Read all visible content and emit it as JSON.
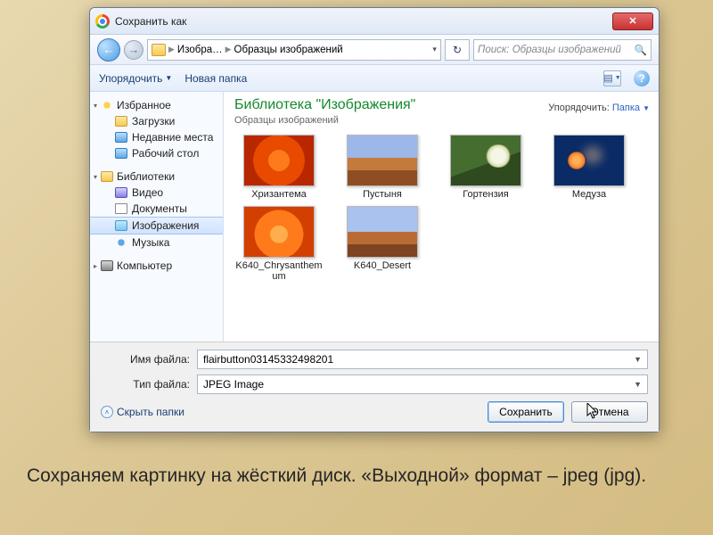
{
  "dialog": {
    "title": "Сохранить как",
    "breadcrumb": {
      "seg1": "Изобра…",
      "seg2": "Образцы изображений"
    },
    "search_placeholder": "Поиск: Образцы изображений",
    "toolbar": {
      "organize": "Упорядочить",
      "new_folder": "Новая папка"
    },
    "sidebar": {
      "favorites": {
        "label": "Избранное",
        "items": [
          "Загрузки",
          "Недавние места",
          "Рабочий стол"
        ]
      },
      "libraries": {
        "label": "Библиотеки",
        "items": [
          "Видео",
          "Документы",
          "Изображения",
          "Музыка"
        ]
      },
      "computer": {
        "label": "Компьютер"
      }
    },
    "library": {
      "title": "Библиотека \"Изображения\"",
      "subtitle": "Образцы изображений",
      "sort_label": "Упорядочить:",
      "sort_value": "Папка"
    },
    "thumbs": [
      {
        "caption": "Хризантема"
      },
      {
        "caption": "Пустыня"
      },
      {
        "caption": "Гортензия"
      },
      {
        "caption": "Медуза"
      },
      {
        "caption": "K640_Chrysanthemum"
      },
      {
        "caption": "K640_Desert"
      }
    ],
    "filename_label": "Имя файла:",
    "filename_value": "flairbutton03145332498201",
    "filetype_label": "Тип файла:",
    "filetype_value": "JPEG Image",
    "hide_folders": "Скрыть папки",
    "save_btn": "Сохранить",
    "cancel_btn": "Отмена"
  },
  "slide_caption": "Сохраняем картинку на жёсткий диск. «Выходной» формат – jpeg (jpg)."
}
